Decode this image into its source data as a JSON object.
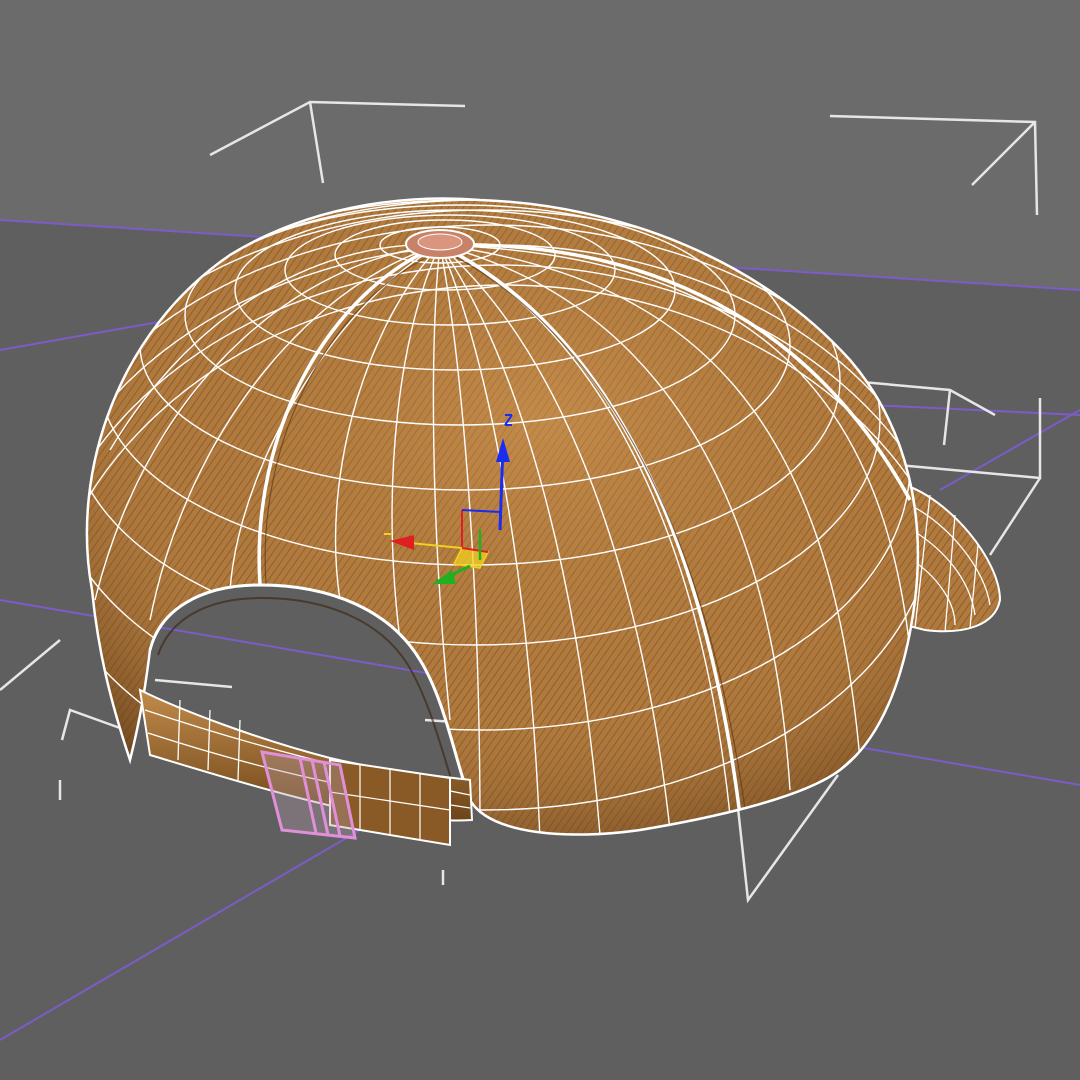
{
  "viewport": {
    "name": "perspective-viewport",
    "background_color": "#6b6b6b",
    "floor_color": "#5f5f5f",
    "grid_line_color": "#7b5cc9",
    "bounding_box_color": "#e6e6e6"
  },
  "scene_object": {
    "name": "baseball-cap",
    "diffuse_color": "#b07a3e",
    "shadow_color": "#5e3a16",
    "wire_color": "#ffffff",
    "button_color": "#c9826a",
    "buckle_color": "#e090d8",
    "selected": true
  },
  "transform_gizmo": {
    "icon": "move-transform-gizmo-icon",
    "axis_x_color": "#e02020",
    "axis_y_color": "#20b020",
    "axis_z_color": "#1a2cf0",
    "plane_color": "#f0d020"
  }
}
